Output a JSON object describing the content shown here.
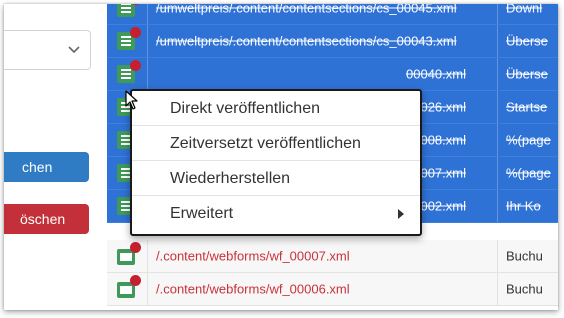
{
  "left_panel": {
    "dropdown_value": "",
    "buttons": [
      {
        "label": "chen",
        "color": "#2f7cc4"
      },
      {
        "label": "öschen",
        "color": "#c4303a"
      }
    ]
  },
  "table": {
    "rows": [
      {
        "path": "/umweltpreis/.content/contentsections/cs_00045.xml",
        "title": "Downl",
        "state": "selected",
        "icon": "document-icon"
      },
      {
        "path": "/umweltpreis/.content/contentsections/cs_00043.xml",
        "title": "Überse",
        "state": "selected",
        "icon": "document-icon"
      },
      {
        "path": "00040.xml",
        "title": "Überse",
        "state": "selected",
        "icon": "document-icon"
      },
      {
        "path": "00026.xml",
        "title": "Startse",
        "state": "selected",
        "icon": "document-icon"
      },
      {
        "path": "00008.xml",
        "title": "%(page",
        "state": "selected",
        "icon": "document-icon"
      },
      {
        "path": "00007.xml",
        "title": "%(page",
        "state": "selected",
        "icon": "document-icon"
      },
      {
        "path": "00002.xml",
        "title": "Ihr Ko",
        "state": "selected",
        "icon": "document-icon"
      },
      {
        "path": "/.content/webforms/wf_00007.xml",
        "title": "Buchu",
        "state": "normal",
        "icon": "mail-icon"
      },
      {
        "path": "/.content/webforms/wf_00006.xml",
        "title": "Buchu",
        "state": "normal",
        "icon": "mail-icon"
      }
    ]
  },
  "context_menu": {
    "items": [
      {
        "label": "Direkt veröffentlichen"
      },
      {
        "label": "Zeitversetzt veröffentlichen"
      },
      {
        "label": "Wiederherstellen"
      },
      {
        "label": "Erweitert",
        "submenu": true
      }
    ]
  },
  "colors": {
    "selection": "#2f72d6",
    "changed_dot": "#c4202f",
    "icon_green": "#3f9a5a",
    "path_red": "#c8323a"
  }
}
